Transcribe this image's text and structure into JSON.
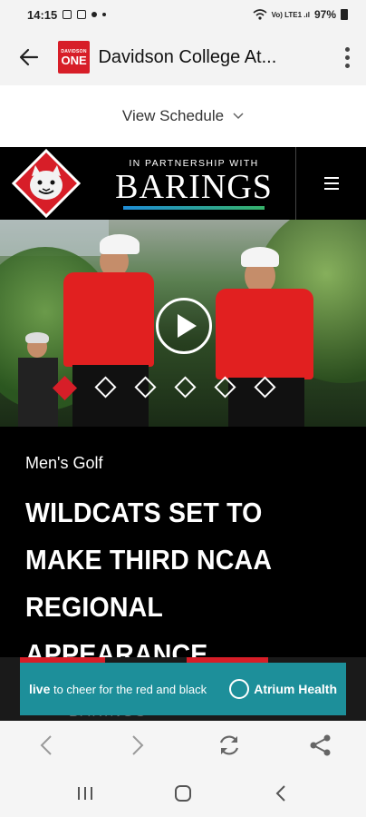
{
  "status_bar": {
    "time": "14:15",
    "signal": "Vo) LTE1 .ıl",
    "battery": "97%"
  },
  "app_bar": {
    "logo_small": "DAVIDSON",
    "logo_large": "ONE",
    "title": "Davidson College At..."
  },
  "schedule": {
    "label": "View Schedule"
  },
  "site_header": {
    "partner_top": "IN PARTNERSHIP WITH",
    "partner_brand": "BARINGS"
  },
  "hero": {
    "slide_count": 6,
    "active_slide": 1
  },
  "article": {
    "category": "Men's Golf",
    "headline": "WILDCATS SET TO MAKE THIRD NCAA REGIONAL APPEARANCE"
  },
  "ad": {
    "text_bold": "live",
    "text": " to cheer for the red and black",
    "brand": "Atrium Health"
  },
  "below": {
    "ghost_text": "BARINGS"
  },
  "colors": {
    "accent": "#d71e28",
    "ad_bg": "#1d8f9a"
  }
}
